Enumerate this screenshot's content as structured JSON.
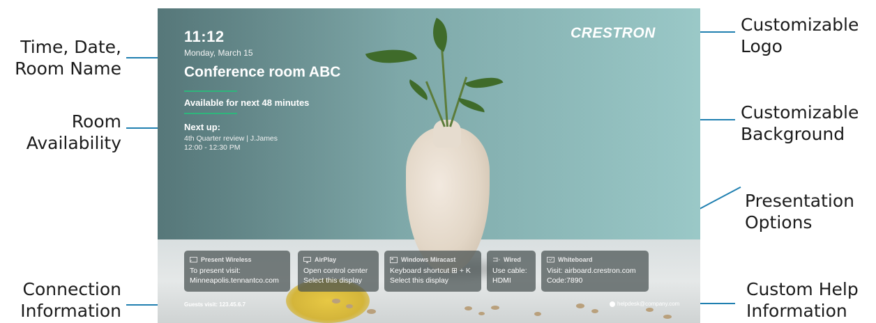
{
  "annotations": {
    "time_date_room": [
      "Time, Date,",
      "Room Name"
    ],
    "room_availability": [
      "Room",
      "Availability"
    ],
    "connection_information": [
      "Connection",
      "Information"
    ],
    "customizable_logo": [
      "Customizable",
      "Logo"
    ],
    "customizable_background": [
      "Customizable",
      "Background"
    ],
    "presentation_options": [
      "Presentation",
      "Options"
    ],
    "custom_help": [
      "Custom Help",
      "Information"
    ],
    "line_color": "#1f7fb0"
  },
  "screen": {
    "time": "11:12",
    "date": "Monday, March 15",
    "room_name": "Conference room ABC",
    "availability": "Available for next 48 minutes",
    "next_up_label": "Next up:",
    "next_meeting": {
      "title": "4th Quarter review | J.James",
      "time": "12:00 - 12:30 PM"
    },
    "logo": "CRESTRON",
    "accent_color": "#2fb57c",
    "cards": [
      {
        "icon": "cast-icon",
        "title": "Present Wireless",
        "lines": [
          "To present visit:",
          "Minneapolis.tennantco.com"
        ]
      },
      {
        "icon": "airplay-icon",
        "title": "AirPlay",
        "lines": [
          "Open control center",
          "Select this display"
        ]
      },
      {
        "icon": "miracast-icon",
        "title": "Windows Miracast",
        "lines": [
          "Keyboard shortcut ⊞ + K",
          "Select this display"
        ]
      },
      {
        "icon": "cable-icon",
        "title": "Wired",
        "lines": [
          "Use cable:",
          "HDMI"
        ]
      },
      {
        "icon": "whiteboard-icon",
        "title": "Whiteboard",
        "lines": [
          "Visit: airboard.crestron.com",
          "Code:7890"
        ]
      }
    ],
    "guests_visit": "Guests visit:  123.45.6.7",
    "help_email": "helpdesk@company.com"
  }
}
